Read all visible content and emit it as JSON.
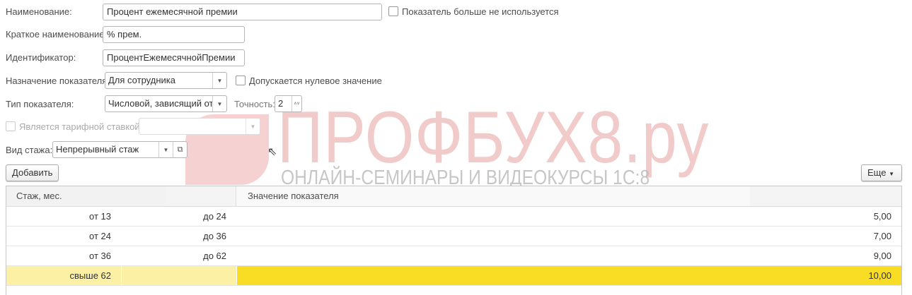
{
  "watermark": {
    "logo": "ПРОФБУХ8.ру",
    "tagline": "ОНЛАЙН-СЕМИНАРЫ И ВИДЕОКУРСЫ 1С:8"
  },
  "form": {
    "name_label": "Наименование:",
    "name_value": "Процент ежемесячной премии",
    "unused_label": "Показатель больше не используется",
    "short_label": "Краткое наименование:",
    "short_value": "% прем.",
    "id_label": "Идентификатор:",
    "id_value": "ПроцентЕжемесячнойПремии",
    "purpose_label": "Назначение показателя:",
    "purpose_value": "Для сотрудника",
    "zero_label": "Допускается нулевое значение",
    "type_label": "Тип показателя:",
    "type_value": "Числовой, зависящий от",
    "precision_label": "Точность:",
    "precision_value": "2",
    "tariff_label": "Является тарифной ставкой",
    "tariff_value": "",
    "seniority_label": "Вид стажа:",
    "seniority_value": "Непрерывный стаж"
  },
  "toolbar": {
    "add": "Добавить",
    "more": "Еще"
  },
  "table": {
    "headers": [
      "Стаж, мес.",
      "Значение показателя"
    ],
    "rows": [
      {
        "from": "от 13",
        "to": "до 24",
        "value": "5,00"
      },
      {
        "from": "от 24",
        "to": "до 36",
        "value": "7,00"
      },
      {
        "from": "от 36",
        "to": "до 62",
        "value": "9,00"
      },
      {
        "from": "свыше 62",
        "to": "",
        "value": "10,00"
      }
    ]
  },
  "colors": {
    "selected_light": "#fcf0a4",
    "selected_accent": "#f9dc24"
  }
}
